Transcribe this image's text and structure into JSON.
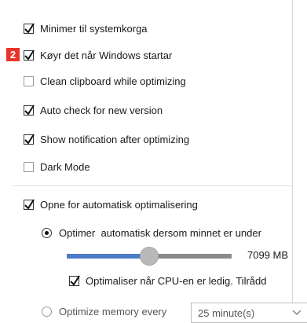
{
  "options": {
    "minimize_to_tray": "Minimer til systemkorga",
    "run_on_startup": "Køyr det når Windows startar",
    "clean_clipboard": "Clean clipboard while optimizing",
    "auto_check": "Auto check for new version",
    "show_notification": "Show notification after optimizing",
    "dark_mode": "Dark Mode"
  },
  "badge": "2",
  "auto": {
    "open_label": "Opne for automatisk optimalisering",
    "radio_memory_label": "Optimer  automatisk dersom minnet er under",
    "slider_value_label": "7099 MB",
    "slider_fraction": 0.5,
    "cpu_idle_label": "Optimaliser når CPU-en er ledig. Tilrådd",
    "radio_every_label": "Optimize memory every",
    "every_value": "25 minute(s)"
  },
  "states": {
    "minimize_to_tray": true,
    "run_on_startup": true,
    "clean_clipboard": false,
    "auto_check": true,
    "show_notification": true,
    "dark_mode": false,
    "open_auto": true,
    "cpu_idle": true
  }
}
